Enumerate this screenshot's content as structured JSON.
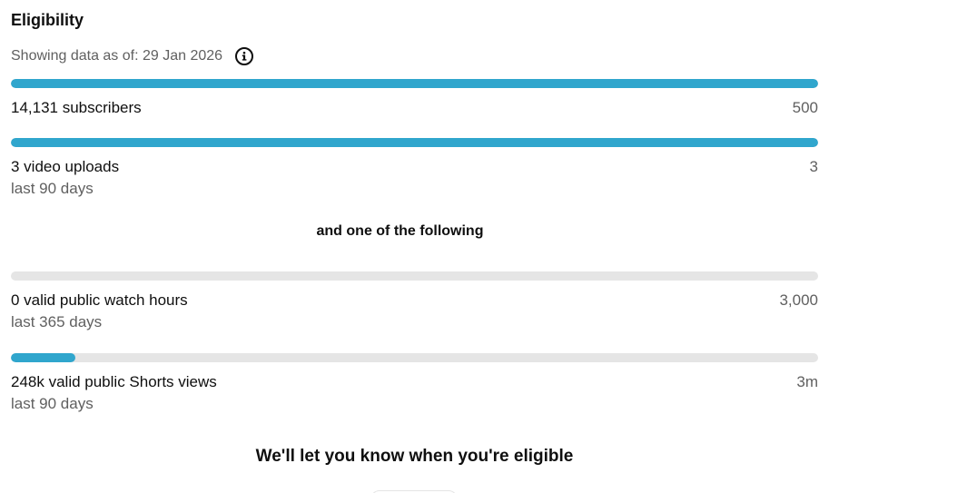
{
  "header": {
    "title": "Eligibility",
    "as_of": "Showing data as of: 29 Jan 2026",
    "info_icon": "info-icon"
  },
  "metrics": [
    {
      "label": "14,131 subscribers",
      "target": "500",
      "progress": 1.0
    },
    {
      "label": "3 video uploads",
      "target": "3",
      "period": "last 90 days",
      "progress": 1.0
    }
  ],
  "divider": {
    "text": "and one of the following"
  },
  "alt_metrics": [
    {
      "label": "0 valid public watch hours",
      "target": "3,000",
      "period": "last 365 days",
      "progress": 0.0
    },
    {
      "label": "248k valid public Shorts views",
      "target": "3m",
      "period": "last 90 days",
      "progress": 0.08
    }
  ],
  "footer": {
    "message": "We'll let you know when you're eligible"
  },
  "colors": {
    "progress_fill": "#30a6cd",
    "progress_track": "#e5e5e5",
    "secondary_text": "#606060"
  }
}
